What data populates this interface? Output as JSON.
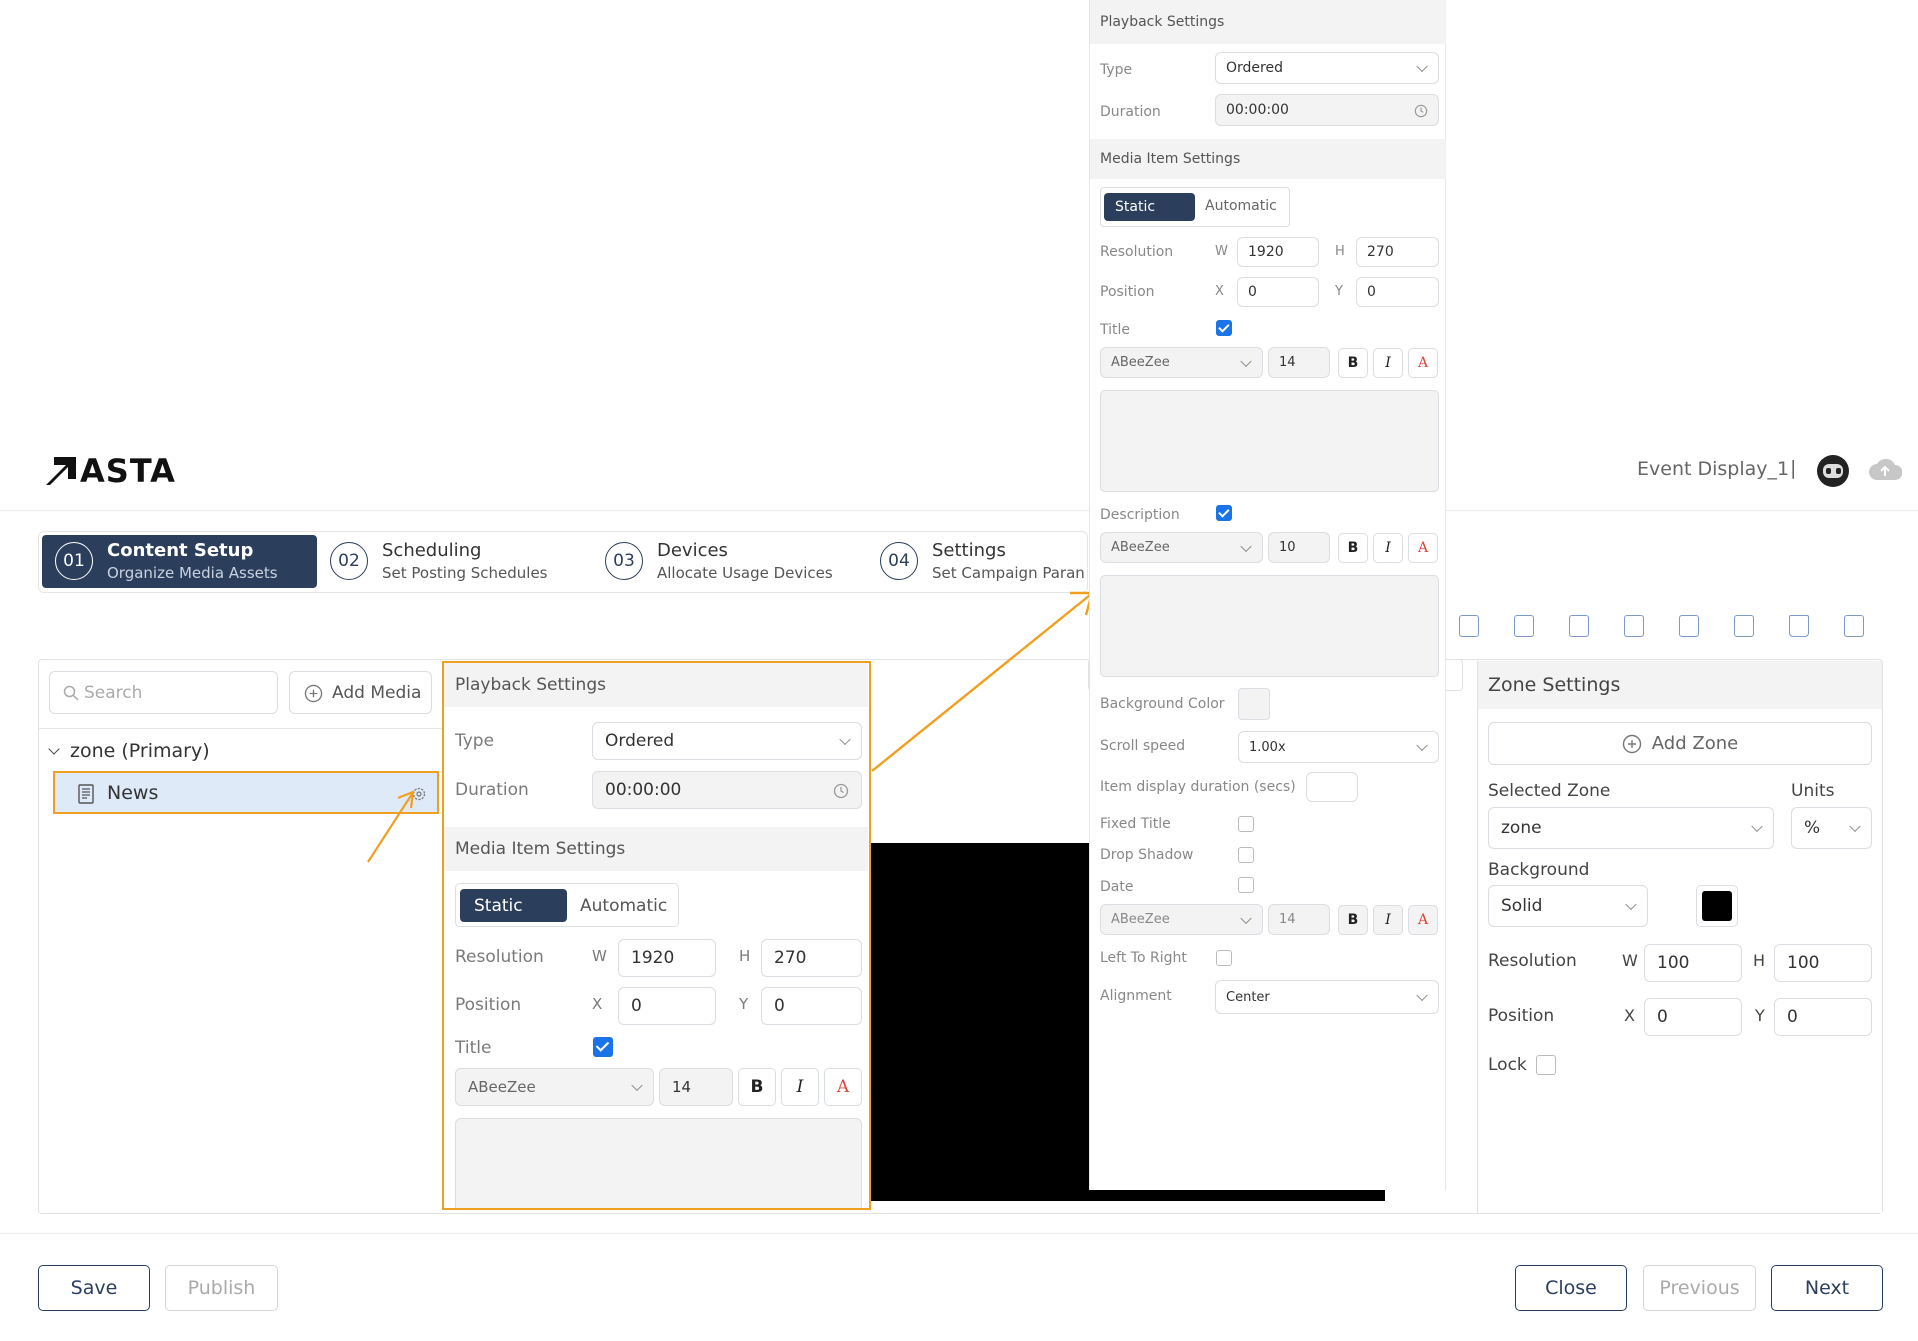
{
  "app": {
    "logo_text": "ASTA",
    "display_name": "Event Display_1",
    "separator": "|"
  },
  "steps": [
    {
      "num": "01",
      "title": "Content Setup",
      "subtitle": "Organize Media Assets"
    },
    {
      "num": "02",
      "title": "Scheduling",
      "subtitle": "Set Posting Schedules"
    },
    {
      "num": "03",
      "title": "Devices",
      "subtitle": "Allocate Usage Devices"
    },
    {
      "num": "04",
      "title": "Settings",
      "subtitle": "Set Campaign Paran"
    }
  ],
  "left_panel": {
    "search_placeholder": "Search",
    "add_media_label": "Add Media",
    "zone_label": "zone (Primary)",
    "media_item": "News"
  },
  "settings_panel": {
    "playback_header": "Playback Settings",
    "type_label": "Type",
    "type_value": "Ordered",
    "duration_label": "Duration",
    "duration_value": "00:00:00",
    "media_header": "Media Item Settings",
    "static_label": "Static",
    "automatic_label": "Automatic",
    "resolution_label": "Resolution",
    "w_label": "W",
    "w_value": "1920",
    "h_label": "H",
    "h_value": "270",
    "position_label": "Position",
    "x_label": "X",
    "x_value": "0",
    "y_label": "Y",
    "y_value": "0",
    "title_label": "Title",
    "font_value": "ABeeZee",
    "title_size": "14",
    "bold_label": "B",
    "italic_label": "I",
    "color_label": "A"
  },
  "zoomed_panel": {
    "description_label": "Description",
    "desc_size": "10",
    "background_color_label": "Background Color",
    "scroll_speed_label": "Scroll speed",
    "scroll_speed_value": "1.00x",
    "item_display_label": "Item display duration (secs)",
    "fixed_title_label": "Fixed Title",
    "drop_shadow_label": "Drop Shadow",
    "date_label": "Date",
    "date_size": "14",
    "left_to_right_label": "Left To Right",
    "alignment_label": "Alignment",
    "alignment_value": "Center"
  },
  "zone_settings": {
    "header": "Zone Settings",
    "add_zone_label": "Add Zone",
    "selected_zone_label": "Selected Zone",
    "selected_zone_value": "zone",
    "units_label": "Units",
    "units_value": "%",
    "background_label": "Background",
    "background_value": "Solid",
    "background_color": "#000000",
    "resolution_label": "Resolution",
    "w_label": "W",
    "w_value": "100",
    "h_label": "H",
    "h_value": "100",
    "position_label": "Position",
    "x_label": "X",
    "x_value": "0",
    "y_label": "Y",
    "y_value": "0",
    "lock_label": "Lock"
  },
  "footer": {
    "save_label": "Save",
    "publish_label": "Publish",
    "close_label": "Close",
    "previous_label": "Previous",
    "next_label": "Next"
  },
  "colors": {
    "primary": "#2b3e5c",
    "highlight": "#f0a020",
    "checkbox": "#1a73e8"
  }
}
